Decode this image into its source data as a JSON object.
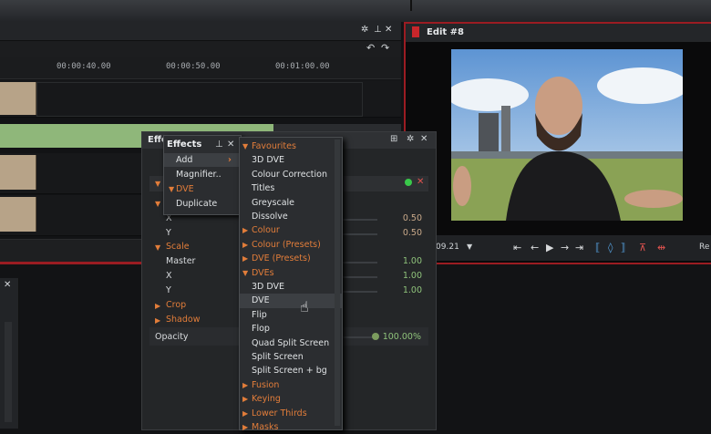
{
  "timeline": {
    "times": [
      "00:00:40.00",
      "00:00:50.00",
      "00:01:00.00"
    ]
  },
  "edit": {
    "title": "Edit #8",
    "timecode": ":09.21",
    "right_label": "Re"
  },
  "fx_panel": {
    "title": "Effe",
    "rows": [
      {
        "label": "X",
        "value": "0.50"
      },
      {
        "label": "Y",
        "value": "0.50"
      },
      {
        "label": "Scale",
        "value": ""
      },
      {
        "label": "Master",
        "value": "1.00"
      },
      {
        "label": "X",
        "value": "1.00"
      },
      {
        "label": "Y",
        "value": "1.00"
      },
      {
        "label": "Crop",
        "value": ""
      },
      {
        "label": "Shadow",
        "value": ""
      }
    ],
    "opacity_label": "Opacity",
    "opacity_value": "100.00%"
  },
  "effects_menu": {
    "title": "Effects",
    "items": [
      "Add",
      "Magnifier..",
      "DVE",
      "Duplicate"
    ]
  },
  "submenu": {
    "items": [
      {
        "label": "Favourites",
        "type": "category"
      },
      {
        "label": "3D DVE",
        "type": "item"
      },
      {
        "label": "Colour Correction",
        "type": "item"
      },
      {
        "label": "Titles",
        "type": "item"
      },
      {
        "label": "Greyscale",
        "type": "item"
      },
      {
        "label": "Dissolve",
        "type": "item"
      },
      {
        "label": "Colour",
        "type": "category"
      },
      {
        "label": "Colour (Presets)",
        "type": "category"
      },
      {
        "label": "DVE (Presets)",
        "type": "category"
      },
      {
        "label": "DVEs",
        "type": "category"
      },
      {
        "label": "3D DVE",
        "type": "item"
      },
      {
        "label": "DVE",
        "type": "item"
      },
      {
        "label": "Flip",
        "type": "item"
      },
      {
        "label": "Flop",
        "type": "item"
      },
      {
        "label": "Quad Split Screen",
        "type": "item"
      },
      {
        "label": "Split Screen",
        "type": "item"
      },
      {
        "label": "Split Screen + bg",
        "type": "item"
      },
      {
        "label": "Fusion",
        "type": "category"
      },
      {
        "label": "Keying",
        "type": "category"
      },
      {
        "label": "Lower Thirds",
        "type": "category"
      },
      {
        "label": "Masks",
        "type": "category"
      }
    ]
  },
  "colors": {
    "accent": "#e27d3a",
    "window_border": "#9b1c22",
    "highlight": "#3c3f43"
  }
}
